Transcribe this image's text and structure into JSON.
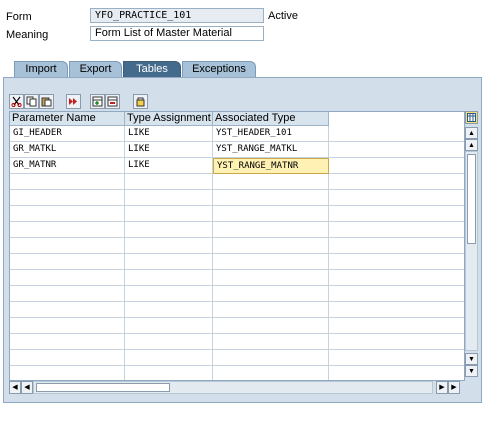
{
  "header": {
    "form_label": "Form",
    "form_value": "YFO_PRACTICE_101",
    "status": "Active",
    "meaning_label": "Meaning",
    "meaning_value": "Form List of Master Material"
  },
  "tabs": [
    {
      "label": "Import",
      "active": false
    },
    {
      "label": "Export",
      "active": false
    },
    {
      "label": "Tables",
      "active": true
    },
    {
      "label": "Exceptions",
      "active": false
    }
  ],
  "toolbar": {
    "buttons": [
      "cut-icon",
      "copy-icon",
      "paste-icon",
      "check-icon",
      "insert-row-icon",
      "delete-row-icon",
      "choose-icon"
    ]
  },
  "grid": {
    "columns": [
      "Parameter Name",
      "Type Assignment",
      "Associated Type"
    ],
    "rows": [
      [
        "GI_HEADER",
        "LIKE",
        "YST_HEADER_101"
      ],
      [
        "GR_MATKL",
        "LIKE",
        "YST_RANGE_MATKL"
      ],
      [
        "GR_MATNR",
        "LIKE",
        "YST_RANGE_MATNR"
      ]
    ]
  },
  "colors": {
    "active_tab": "#446a8c",
    "panel_bg": "#d2dfea",
    "selected_cell": "#fff1b3"
  }
}
